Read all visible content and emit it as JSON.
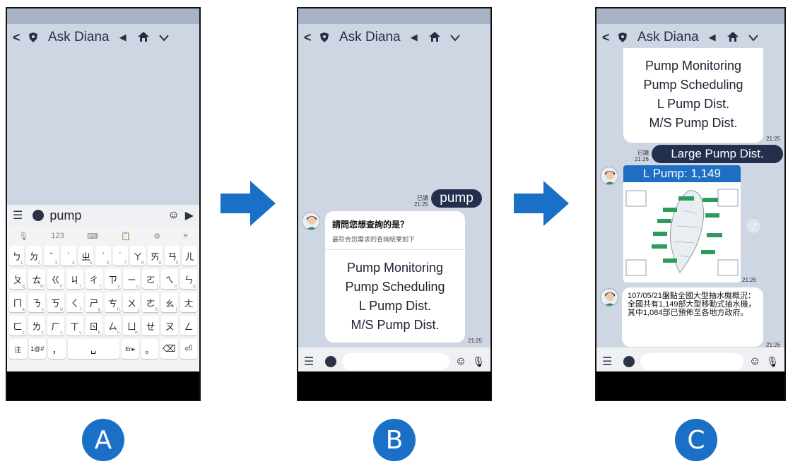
{
  "header": {
    "title": "Ask Diana"
  },
  "phone_a": {
    "input_text": "pump",
    "toolbar_count": "123",
    "keyboard_rows": [
      [
        [
          "ㄅ",
          "1"
        ],
        [
          "ㄉ",
          "2"
        ],
        [
          "ˇ",
          "3"
        ],
        [
          "ˋ",
          "4"
        ],
        [
          "ㄓ",
          "5"
        ],
        [
          "ˊ",
          "6"
        ],
        [
          "˙",
          "7"
        ],
        [
          "ㄚ",
          "8"
        ],
        [
          "ㄞ",
          "9"
        ],
        [
          "ㄢ",
          "0"
        ],
        [
          "ㄦ",
          ""
        ]
      ],
      [
        [
          "ㄆ",
          "q"
        ],
        [
          "ㄊ",
          "w"
        ],
        [
          "ㄍ",
          "e"
        ],
        [
          "ㄐ",
          "r"
        ],
        [
          "ㄔ",
          "t"
        ],
        [
          "ㄗ",
          "y"
        ],
        [
          "ㄧ",
          "u"
        ],
        [
          "ㄛ",
          "i"
        ],
        [
          "ㄟ",
          "o"
        ],
        [
          "ㄣ",
          "p"
        ]
      ],
      [
        [
          "ㄇ",
          "a"
        ],
        [
          "ㄋ",
          "s"
        ],
        [
          "ㄎ",
          "d"
        ],
        [
          "ㄑ",
          "f"
        ],
        [
          "ㄕ",
          "g"
        ],
        [
          "ㄘ",
          "h"
        ],
        [
          "ㄨ",
          "j"
        ],
        [
          "ㄜ",
          "k"
        ],
        [
          "ㄠ",
          "l"
        ],
        [
          "ㄤ",
          ""
        ]
      ],
      [
        [
          "ㄈ",
          "z"
        ],
        [
          "ㄌ",
          "x"
        ],
        [
          "ㄏ",
          "c"
        ],
        [
          "ㄒ",
          "v"
        ],
        [
          "ㄖ",
          "b"
        ],
        [
          "ㄙ",
          "n"
        ],
        [
          "ㄩ",
          "m"
        ],
        [
          "ㄝ",
          ""
        ],
        [
          "ㄡ",
          ""
        ],
        [
          "ㄥ",
          ""
        ]
      ]
    ],
    "bottom_keys": [
      "注",
      "1@#",
      "，",
      "En▸",
      "。"
    ]
  },
  "phone_b": {
    "user_message": "pump",
    "read_label": "已讀",
    "user_time": "21:25",
    "bot_question": "請問您想查詢的是？",
    "bot_subtitle": "最符合您需求的查詢結果如下",
    "options": [
      "Pump Monitoring",
      "Pump Scheduling",
      "L Pump Dist.",
      "M/S Pump Dist."
    ],
    "bot_time": "21:25"
  },
  "phone_c": {
    "options": [
      "Pump Monitoring",
      "Pump Scheduling",
      "L Pump Dist.",
      "M/S Pump Dist."
    ],
    "options_time": "21:25",
    "user_message": "Large Pump Dist.",
    "read_label": "已讀",
    "user_time": "21:26",
    "map_title": "L Pump: 1,149",
    "map_time": "21:26",
    "text_message": "107/05/21盤點全國大型抽水機概況：\n全國共有1,149部大型移動式抽水機，其中1,084部已預佈至各地方政府。",
    "text_time": "21:26"
  },
  "labels": [
    "A",
    "B",
    "C"
  ],
  "colors": {
    "accent": "#1a6fc7",
    "bubble": "#22304d",
    "chat_bg": "#cfd6e3"
  }
}
